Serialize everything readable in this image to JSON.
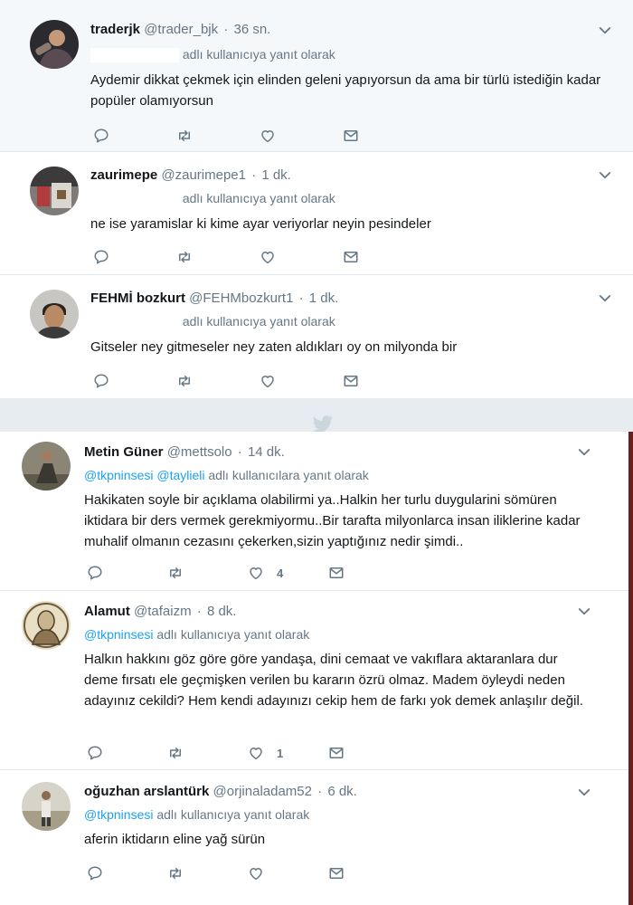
{
  "tweets": [
    {
      "name": "traderjk",
      "handle": "@trader_bjk",
      "time": "36 sn.",
      "reply_prefix": "",
      "reply_label": "adlı kullanıcıya yanıt olarak",
      "text": "Aydemir dikkat çekmek için elinden geleni yapıyorsun da ama bir türlü istediğin kadar popüler olamıyorsun",
      "likes": ""
    },
    {
      "name": "zaurimepe",
      "handle": "@zaurimepe1",
      "time": "1 dk.",
      "reply_prefix": "",
      "reply_label": "adlı kullanıcıya yanıt olarak",
      "text": "ne ise yaramislar ki kime ayar veriyorlar neyin pesindeler",
      "likes": ""
    },
    {
      "name": "FEHMİ bozkurt",
      "handle": "@FEHMbozkurt1",
      "time": "1 dk.",
      "reply_prefix": "",
      "reply_label": "adlı kullanıcıya yanıt olarak",
      "text": "Gitseler ney gitmeseler ney zaten aldıkları oy on milyonda bir",
      "likes": ""
    },
    {
      "name": "Metin Güner",
      "handle": "@mettsolo",
      "time": "14 dk.",
      "reply_prefix": "@tkpninsesi @taylieli",
      "reply_label": "adlı kullanıcılara yanıt olarak",
      "text": "Hakikaten soyle bir açıklama olabilirmi ya..Halkin her turlu duygularini sömüren iktidara bir ders vermek gerekmiyormu..Bir tarafta milyonlarca insan iliklerine kadar muhalif olmanın cezasını çekerken,sizin yaptığınız nedir şimdi..",
      "likes": "4"
    },
    {
      "name": "Alamut",
      "handle": "@tafaizm",
      "time": "8 dk.",
      "reply_prefix": "@tkpninsesi",
      "reply_label": "adlı kullanıcıya yanıt olarak",
      "text": "Halkın hakkını göz göre  göre yandaşa, dini cemaat ve vakıflara aktaranlara dur deme fırsatı ele geçmişken verilen bu kararın özrü olmaz. Madem öyleydi neden adayınız cekildi? Hem kendi adayınızı cekip hem de farkı yok demek anlaşılır değil.",
      "likes": "1"
    },
    {
      "name": "oğuzhan arslantürk",
      "handle": "@orjinaladam52",
      "time": "6 dk.",
      "reply_prefix": "@tkpninsesi",
      "reply_label": "adlı kullanıcıya yanıt olarak",
      "text": "aferin iktidarın eline yağ sürün",
      "likes": ""
    }
  ],
  "colors": {
    "accent": "#1da1f2",
    "muted": "#657786",
    "text": "#14171a",
    "border": "#e1e8ed",
    "highlight": "#f5f8fa",
    "background": "#e6ecf0"
  },
  "icons": [
    "reply-icon",
    "retweet-icon",
    "like-icon",
    "direct-message-icon",
    "chevron-down-icon",
    "twitter-bird-icon"
  ]
}
